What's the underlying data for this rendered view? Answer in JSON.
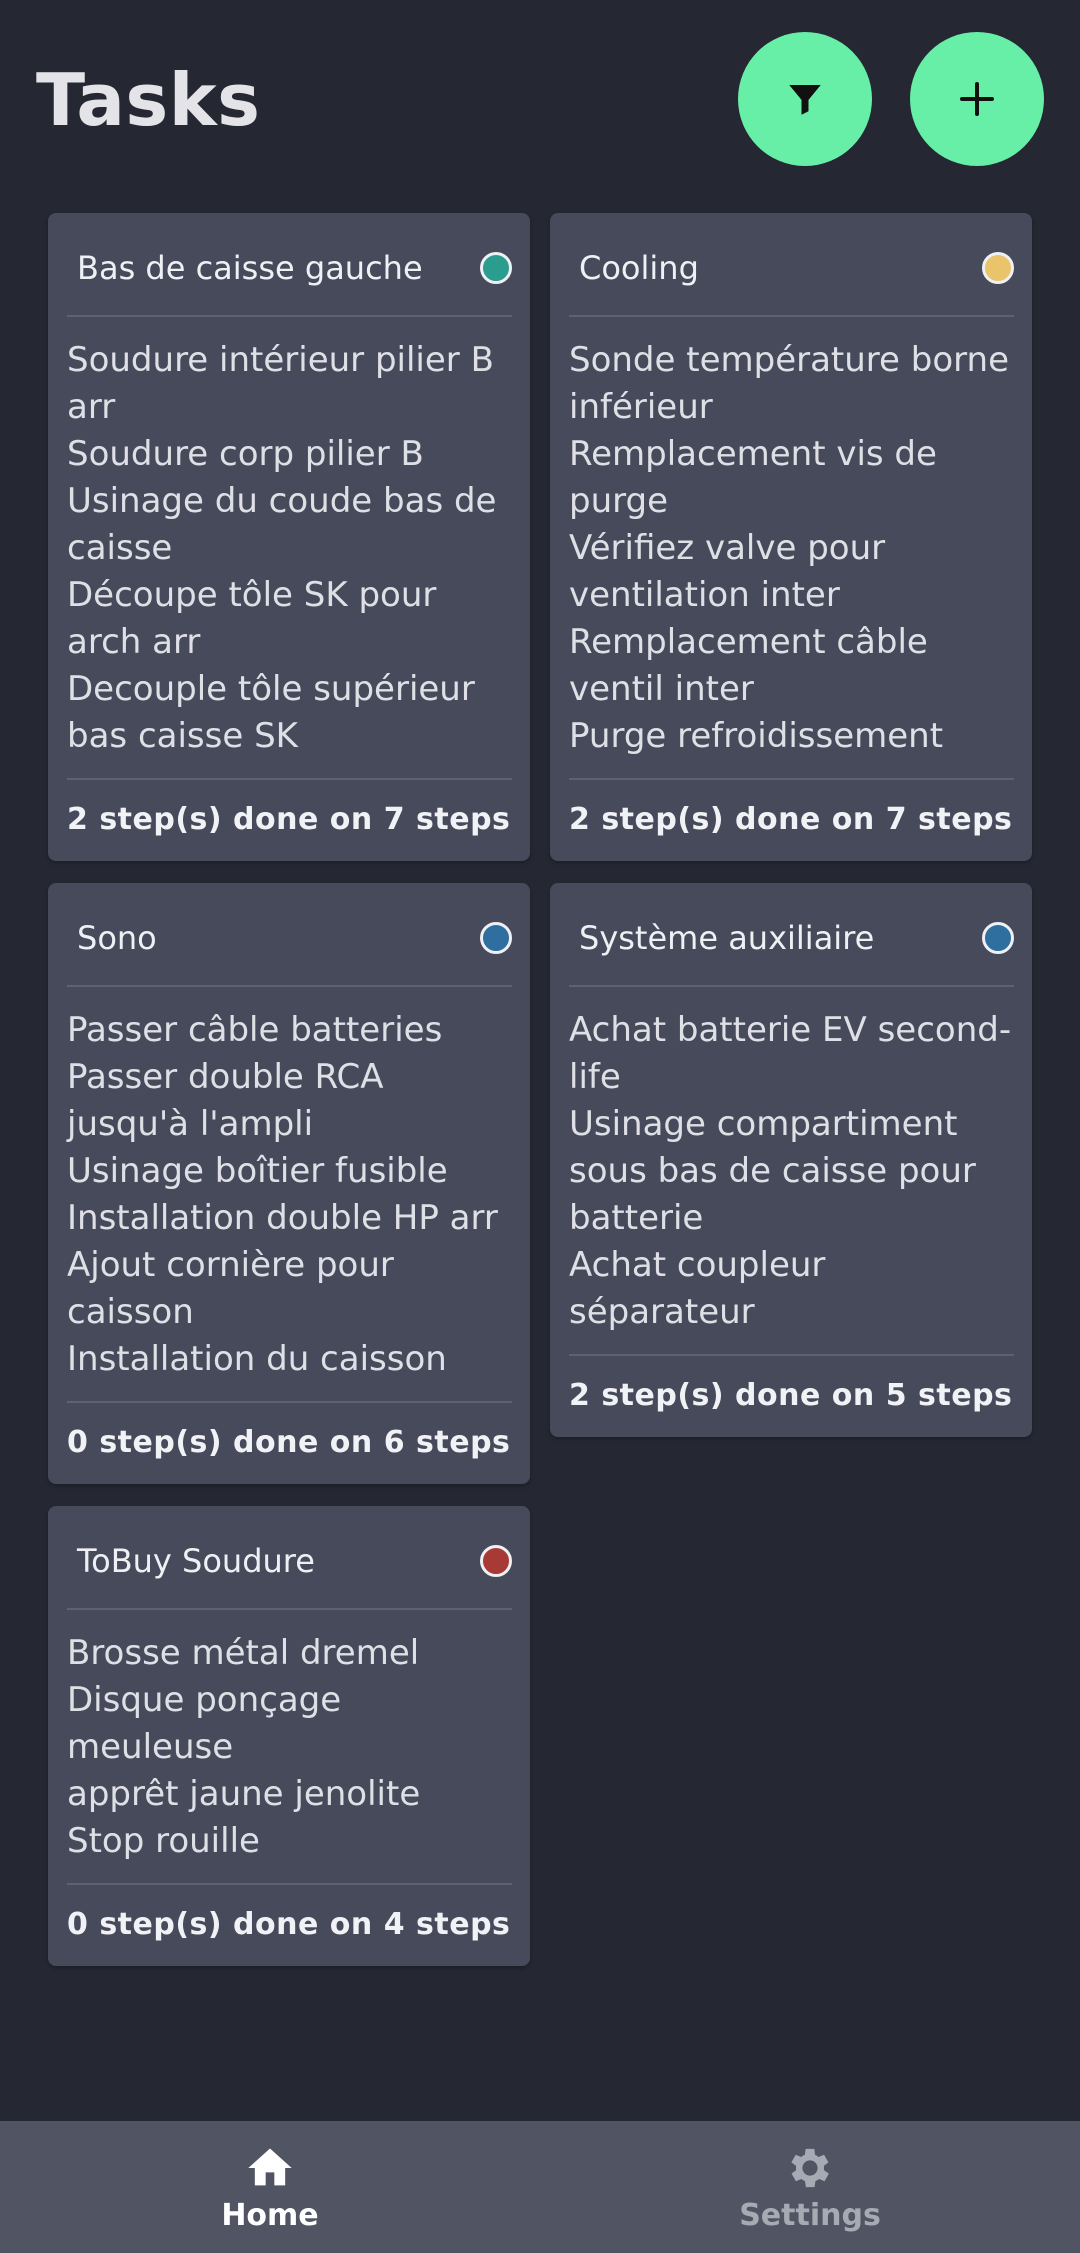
{
  "header": {
    "title": "Tasks"
  },
  "actions": {
    "filter_icon": "filter-icon",
    "add_icon": "plus-icon"
  },
  "cards": [
    {
      "title": "Bas de caisse gauche",
      "color": "#2a9d8f",
      "steps": [
        "Soudure intérieur pilier B arr",
        "Soudure corp pilier B",
        "Usinage du coude bas de caisse",
        "Découpe tôle SK pour arch arr",
        "Decouple tôle supérieur bas caisse SK"
      ],
      "summary": "2 step(s) done on 7 steps"
    },
    {
      "title": "Cooling",
      "color": "#e9c46a",
      "steps": [
        "Sonde température borne inférieur",
        "Remplacement vis de purge",
        "Vérifiez valve pour ventilation inter",
        "Remplacement câble ventil inter",
        "Purge refroidissement"
      ],
      "summary": "2 step(s) done on 7 steps"
    },
    {
      "title": "Sono",
      "color": "#2f6f9f",
      "steps": [
        "Passer câble batteries",
        "Passer double RCA jusqu'à l'ampli",
        "Usinage boîtier fusible",
        "Installation double HP arr",
        "Ajout cornière pour caisson",
        "Installation du caisson"
      ],
      "summary": "0 step(s) done on 6 steps"
    },
    {
      "title": "Système auxiliaire",
      "color": "#2f6f9f",
      "steps": [
        "Achat batterie EV second-life",
        "Usinage compartiment sous bas de caisse pour batterie",
        "Achat coupleur séparateur"
      ],
      "summary": "2 step(s) done on 5 steps"
    },
    {
      "title": "ToBuy Soudure",
      "color": "#a83a36",
      "steps": [
        "Brosse métal dremel",
        "Disque ponçage meuleuse",
        "apprêt jaune jenolite",
        "Stop rouille"
      ],
      "summary": "0 step(s) done on 4 steps"
    }
  ],
  "nav": {
    "home_label": "Home",
    "settings_label": "Settings",
    "home_icon": "home-icon",
    "settings_icon": "gear-icon",
    "active": "Home"
  },
  "colors": {
    "accent": "#67efa8",
    "background": "#252732",
    "card": "#474a5b",
    "nav": "#515463"
  }
}
